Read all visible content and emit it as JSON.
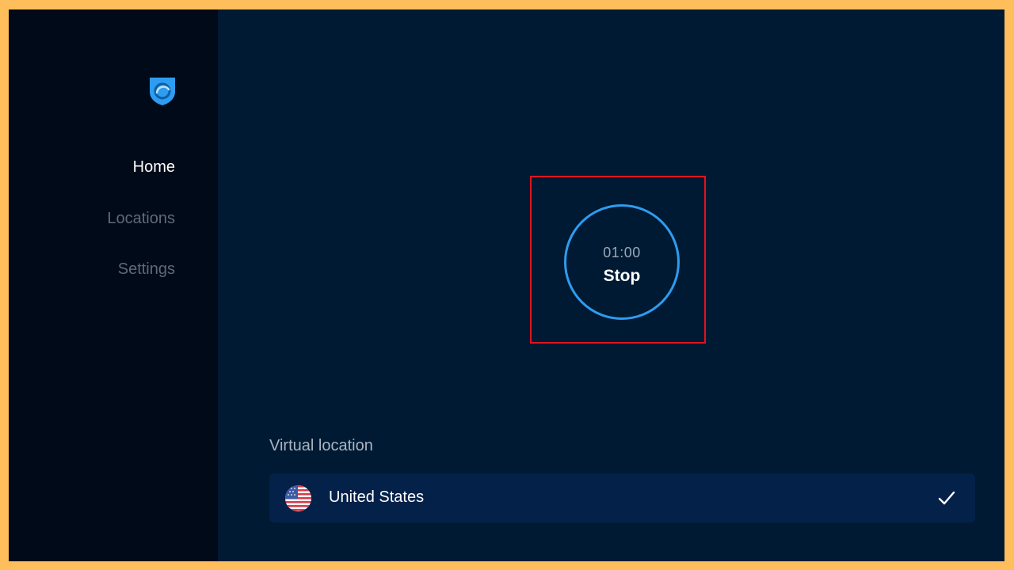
{
  "app": {
    "logo_icon": "shield-logo-icon"
  },
  "sidebar": {
    "items": [
      {
        "label": "Home",
        "active": true
      },
      {
        "label": "Locations",
        "active": false
      },
      {
        "label": "Settings",
        "active": false
      }
    ]
  },
  "main": {
    "connection": {
      "timer": "01:00",
      "button_label": "Stop",
      "ring_color": "#2E9CF0"
    },
    "virtual_location": {
      "section_label": "Virtual location",
      "selected": {
        "name": "United States",
        "flag_icon": "us-flag-icon",
        "check_icon": "check-icon"
      }
    }
  },
  "colors": {
    "background": "#001A33",
    "sidebar_background": "#000A18",
    "accent": "#2E9CF0",
    "highlight": "#E0141E"
  }
}
